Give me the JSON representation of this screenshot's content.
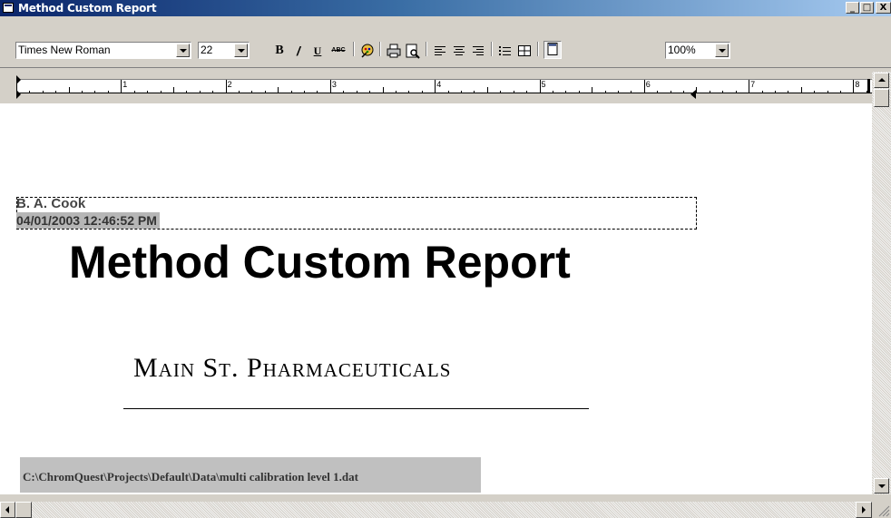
{
  "window": {
    "title": "Method Custom Report",
    "minimize_label": "_",
    "maximize_label": "□",
    "close_label": "X"
  },
  "toolbar": {
    "font_family": "Times New Roman",
    "font_size": "22",
    "bold_label": "B",
    "italic_label": "/",
    "underline_label": "U",
    "strike_label": "ABC",
    "zoom": "100%",
    "icons": [
      "bold-icon",
      "italic-icon",
      "underline-icon",
      "strikethrough-icon",
      "color-icon",
      "print-icon",
      "print-preview-icon",
      "align-left-icon",
      "align-center-icon",
      "align-right-icon",
      "bullets-icon",
      "table-icon",
      "page-icon"
    ]
  },
  "ruler": {
    "numbers": [
      "1",
      "2",
      "3",
      "4",
      "5",
      "6",
      "7",
      "8"
    ]
  },
  "document": {
    "author": "B. A. Cook",
    "timestamp": "04/01/2003 12:46:52 PM",
    "title": "Method Custom Report",
    "company": "Main St. Pharmaceuticals",
    "data_path": "C:\\ChromQuest\\Projects\\Default\\Data\\multi calibration level 1.dat"
  },
  "colors": {
    "titlebar_start": "#0a246a",
    "titlebar_end": "#a6caf0",
    "chrome": "#d4d0c8",
    "field_highlight": "#c0c0c0"
  }
}
